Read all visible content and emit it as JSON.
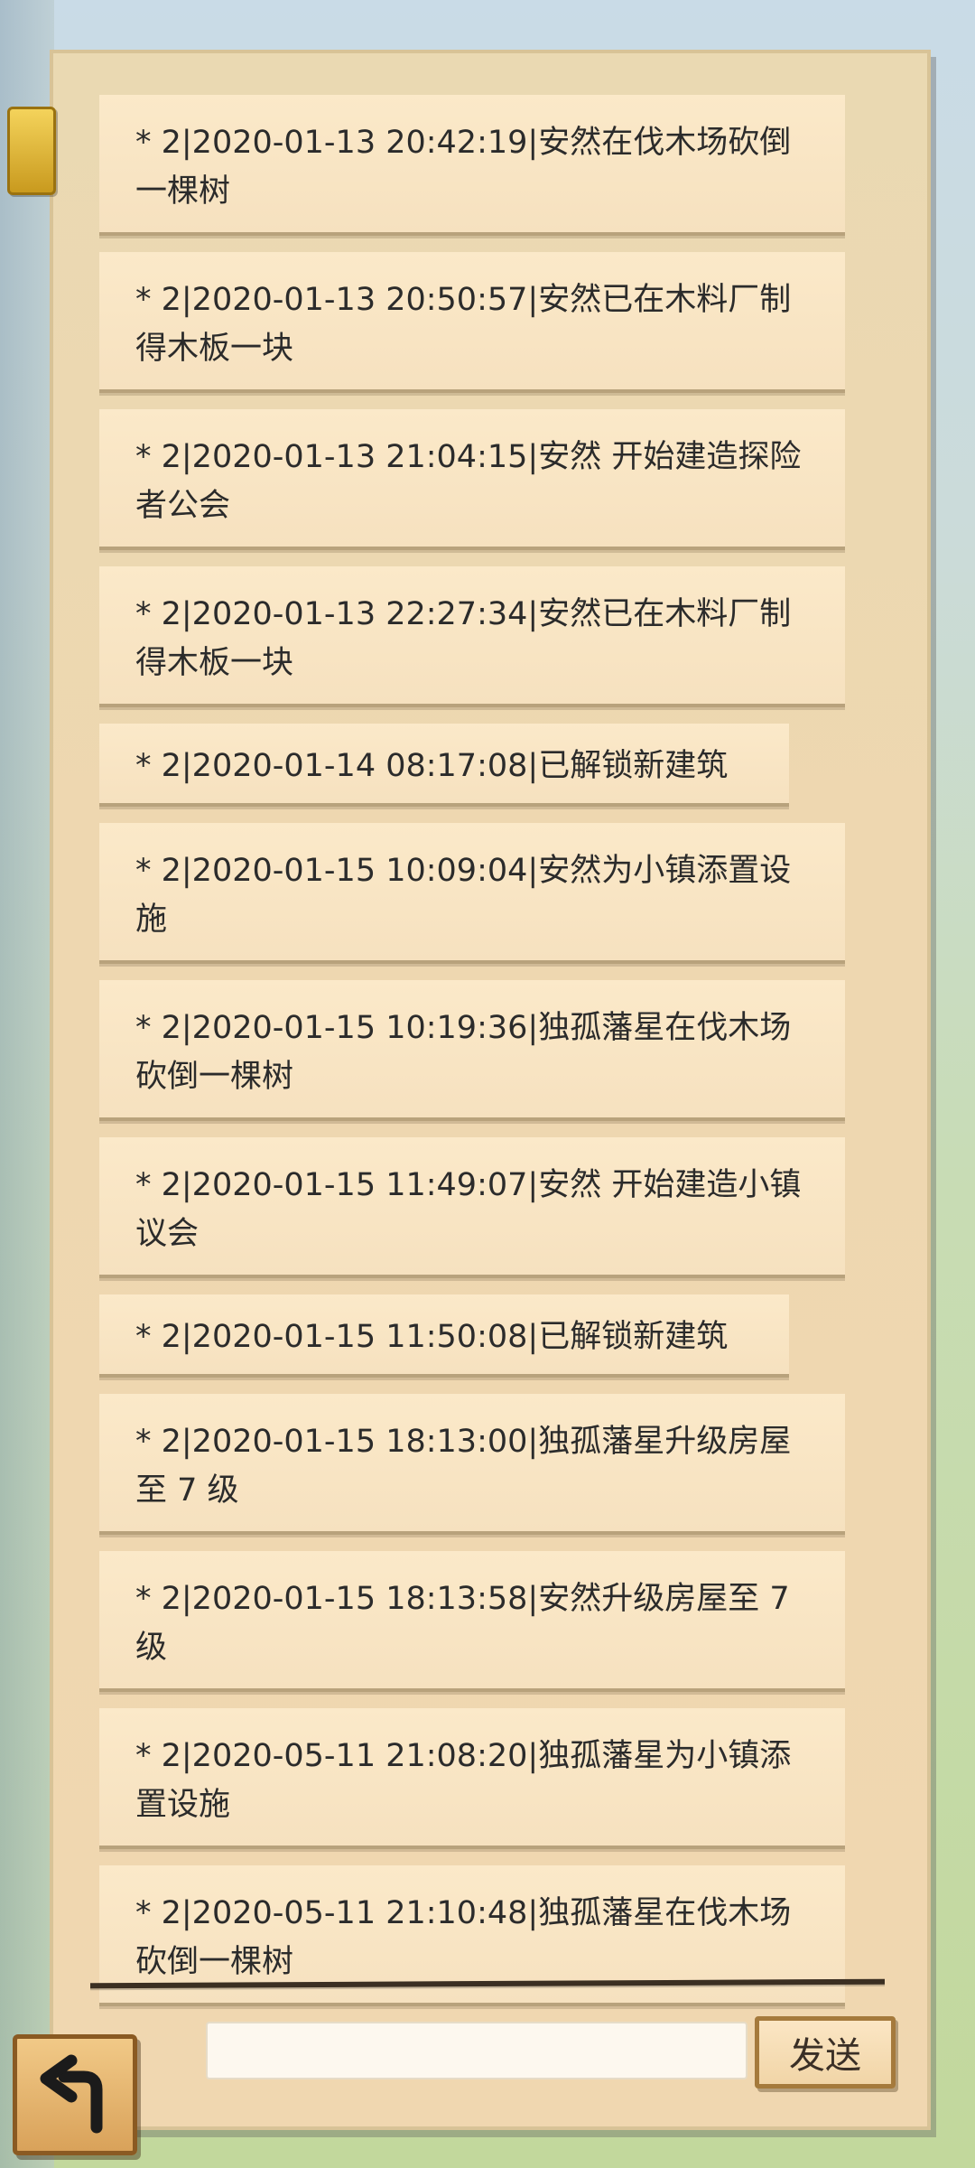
{
  "logs": [
    {
      "text": "* 2|2020-01-13 20:42:19|安然在伐木场砍倒一棵树",
      "single_line": false
    },
    {
      "text": "* 2|2020-01-13 20:50:57|安然已在木料厂制得木板一块",
      "single_line": false
    },
    {
      "text": "* 2|2020-01-13 21:04:15|安然 开始建造探险者公会",
      "single_line": false
    },
    {
      "text": "* 2|2020-01-13 22:27:34|安然已在木料厂制得木板一块",
      "single_line": false
    },
    {
      "text": "* 2|2020-01-14 08:17:08|已解锁新建筑",
      "single_line": true
    },
    {
      "text": "* 2|2020-01-15 10:09:04|安然为小镇添置设施",
      "single_line": false
    },
    {
      "text": "* 2|2020-01-15 10:19:36|独孤藩星在伐木场砍倒一棵树",
      "single_line": false
    },
    {
      "text": "* 2|2020-01-15 11:49:07|安然 开始建造小镇议会",
      "single_line": false
    },
    {
      "text": "* 2|2020-01-15 11:50:08|已解锁新建筑",
      "single_line": true
    },
    {
      "text": "* 2|2020-01-15 18:13:00|独孤藩星升级房屋至 7 级",
      "single_line": false
    },
    {
      "text": "* 2|2020-01-15 18:13:58|安然升级房屋至 7 级",
      "single_line": false
    },
    {
      "text": "* 2|2020-05-11 21:08:20|独孤藩星为小镇添置设施",
      "single_line": false
    },
    {
      "text": "* 2|2020-05-11 21:10:48|独孤藩星在伐木场砍倒一棵树",
      "single_line": false
    }
  ],
  "input": {
    "value": "",
    "placeholder": ""
  },
  "send_button": {
    "label": "发送"
  },
  "icons": {
    "back": "back-arrow-icon",
    "clip": "paper-clip-icon"
  }
}
